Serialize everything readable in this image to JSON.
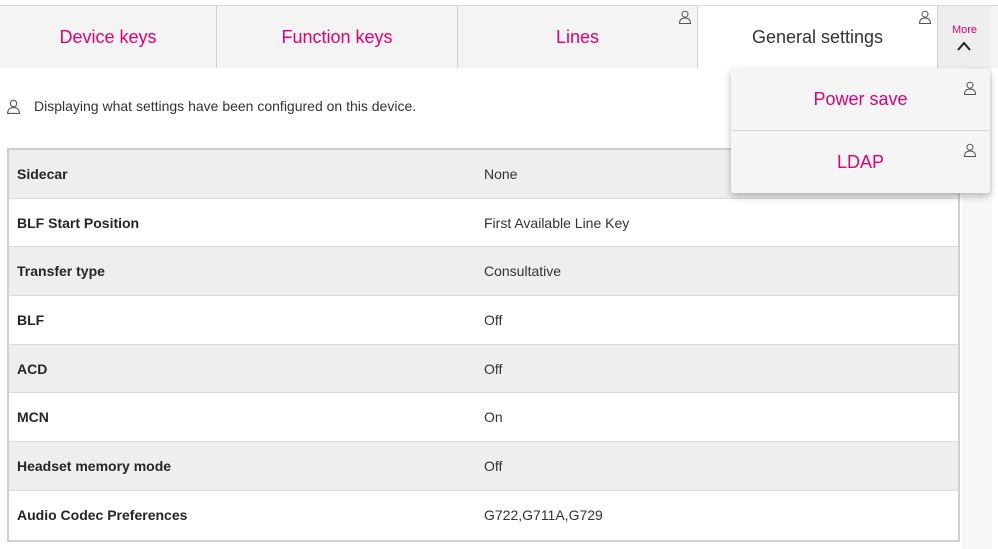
{
  "tabs": [
    {
      "label": "Device keys",
      "active": false,
      "has_user_icon": false
    },
    {
      "label": "Function keys",
      "active": false,
      "has_user_icon": false
    },
    {
      "label": "Lines",
      "active": false,
      "has_user_icon": true
    },
    {
      "label": "General settings",
      "active": true,
      "has_user_icon": true
    }
  ],
  "more": {
    "label": "More",
    "icon": "chevron-up-icon"
  },
  "info_text": "Displaying what settings have been configured on this device.",
  "settings": [
    {
      "key": "Sidecar",
      "value": "None"
    },
    {
      "key": "BLF Start Position",
      "value": "First Available Line Key"
    },
    {
      "key": "Transfer type",
      "value": "Consultative"
    },
    {
      "key": "BLF",
      "value": "Off"
    },
    {
      "key": "ACD",
      "value": "Off"
    },
    {
      "key": "MCN",
      "value": "On"
    },
    {
      "key": "Headset memory mode",
      "value": "Off"
    },
    {
      "key": "Audio Codec Preferences",
      "value": "G722,G711A,G729"
    }
  ],
  "more_menu": [
    {
      "label": "Power save",
      "icon": "user-icon"
    },
    {
      "label": "LDAP",
      "icon": "user-icon"
    }
  ],
  "colors": {
    "accent": "#e20074",
    "row_shade": "#eeeeee",
    "text": "#333333"
  }
}
